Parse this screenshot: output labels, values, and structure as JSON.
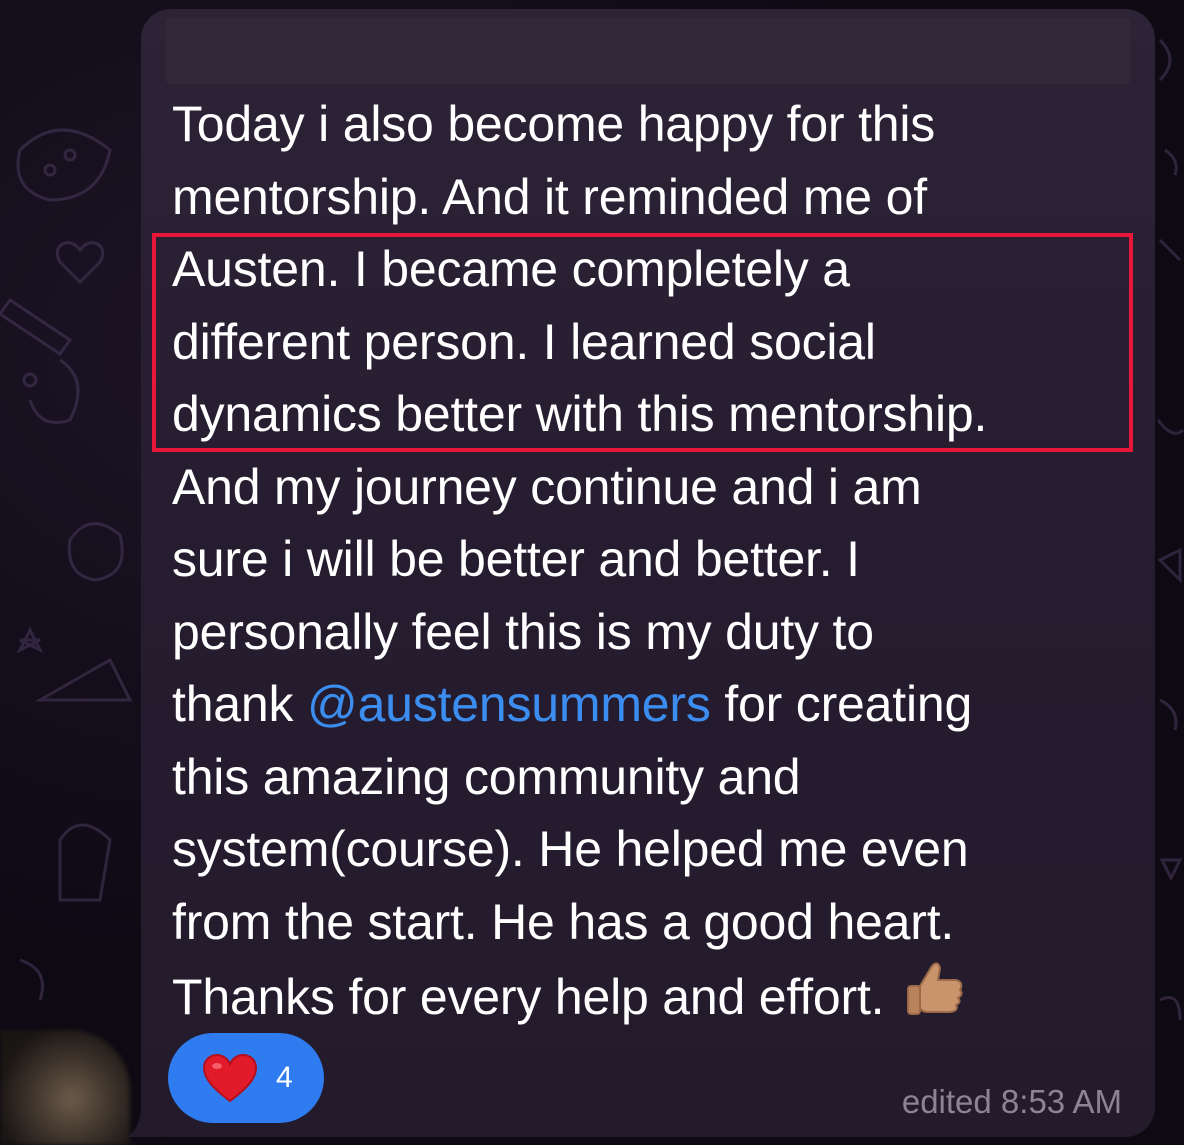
{
  "message": {
    "lines": [
      "Today i also become happy for this",
      "mentorship. And it reminded me of",
      "Austen. I became completely a",
      "different person. I learned social",
      "dynamics better with this mentorship.",
      "And my journey continue and i am",
      "sure i will be better and better.  I",
      "personally feel this is my duty to",
      "thank ",
      "this amazing community and",
      "system(course). He helped me even",
      "from the start. He has a good heart.",
      "Thanks for every help and effort. "
    ],
    "mention": "@austensummers",
    "after_mention": " for creating",
    "emoji": "thumbs-up"
  },
  "reaction": {
    "icon": "heart-icon",
    "count": "4",
    "color": "#2f7cf0"
  },
  "meta": {
    "status": "edited 8:53 AM"
  },
  "highlight": {
    "color": "#e8173a"
  }
}
